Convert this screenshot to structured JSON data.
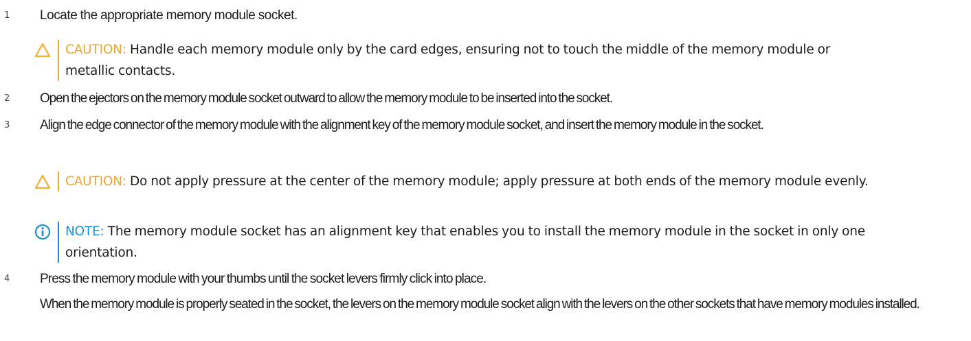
{
  "steps": [
    {
      "number": "1",
      "text": "Locate the appropriate memory module socket."
    },
    {
      "number": "2",
      "text": "Open the ejectors on the memory module socket outward to allow the memory module to be inserted into the socket."
    },
    {
      "number": "3",
      "text": "Align the edge connector of the memory module with the alignment key of the memory module socket, and insert the memory module in the socket."
    },
    {
      "number": "4",
      "text": "Press the memory module with your thumbs until the socket levers firmly click into place.",
      "detail": "When the memory module is properly seated in the socket, the levers on the memory module socket align with the levers on the other sockets that have memory modules installed."
    }
  ],
  "callouts": {
    "caution_1": {
      "label": "CAUTION:",
      "text": "Handle each memory module only by the card edges, ensuring not to touch the middle of the memory module or metallic contacts.",
      "icon": "warning-triangle-icon"
    },
    "caution_2": {
      "label": "CAUTION:",
      "text": "Do not apply pressure at the center of the memory module; apply pressure at both ends of the memory module evenly.",
      "icon": "warning-triangle-icon"
    },
    "note_1": {
      "label": "NOTE:",
      "text": "The memory module socket has an alignment key that enables you to install the memory module in the socket in only one orientation.",
      "icon": "info-circle-icon"
    }
  },
  "colors": {
    "caution": "#f2af2f",
    "note": "#1f8fd6",
    "text": "#1c1c1c"
  }
}
